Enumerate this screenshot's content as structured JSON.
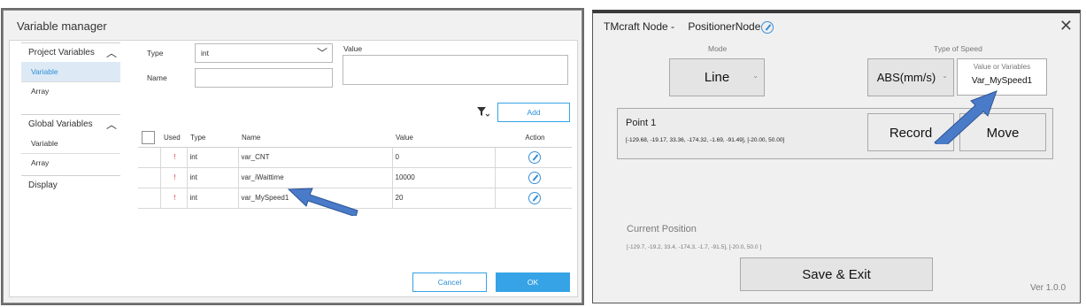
{
  "variable_manager": {
    "title": "Variable manager",
    "sidebar": {
      "project_variables": "Project Variables",
      "project_items": [
        "Variable",
        "Array"
      ],
      "global_variables": "Global Variables",
      "global_items": [
        "Variable",
        "Array"
      ],
      "display": "Display"
    },
    "form": {
      "type_label": "Type",
      "type_value": "int",
      "name_label": "Name",
      "name_value": "",
      "value_label": "Value",
      "add_button": "Add"
    },
    "table": {
      "headers": [
        "Used",
        "Type",
        "Name",
        "Value",
        "Action"
      ],
      "rows": [
        {
          "used": "!",
          "type": "int",
          "name": "var_CNT",
          "value": "0"
        },
        {
          "used": "!",
          "type": "int",
          "name": "var_iWaittime",
          "value": "10000"
        },
        {
          "used": "!",
          "type": "int",
          "name": "var_MySpeed1",
          "value": "20"
        }
      ]
    },
    "cancel_button": "Cancel",
    "ok_button": "OK"
  },
  "tm_node": {
    "title": "TMcraft Node -",
    "node_name": "PositionerNode",
    "mode_label": "Mode",
    "mode_value": "Line",
    "speed_type_label": "Type of Speed",
    "speed_type_value": "ABS(mm/s)",
    "value_or_variables_label": "Value or Variables",
    "value_or_variables_value": "Var_MySpeed1",
    "point_title": "Point 1",
    "point_values": "[-129.68, -19.17, 33.36, -174.32, -1.69, -91.49], [-20.00, 50.00]",
    "record_button": "Record",
    "move_button": "Move",
    "current_position_label": "Current Position",
    "current_position_values": "[-129.7, -19.2, 33.4, -174.3, -1.7, -91.5], [-20.0, 50.0 ]",
    "save_exit_button": "Save & Exit",
    "version": "Ver 1.0.0"
  },
  "colors": {
    "accent_blue": "#36a3e6",
    "arrow_blue": "#4a7bc8",
    "active_item_bg": "#ddeaf6"
  }
}
